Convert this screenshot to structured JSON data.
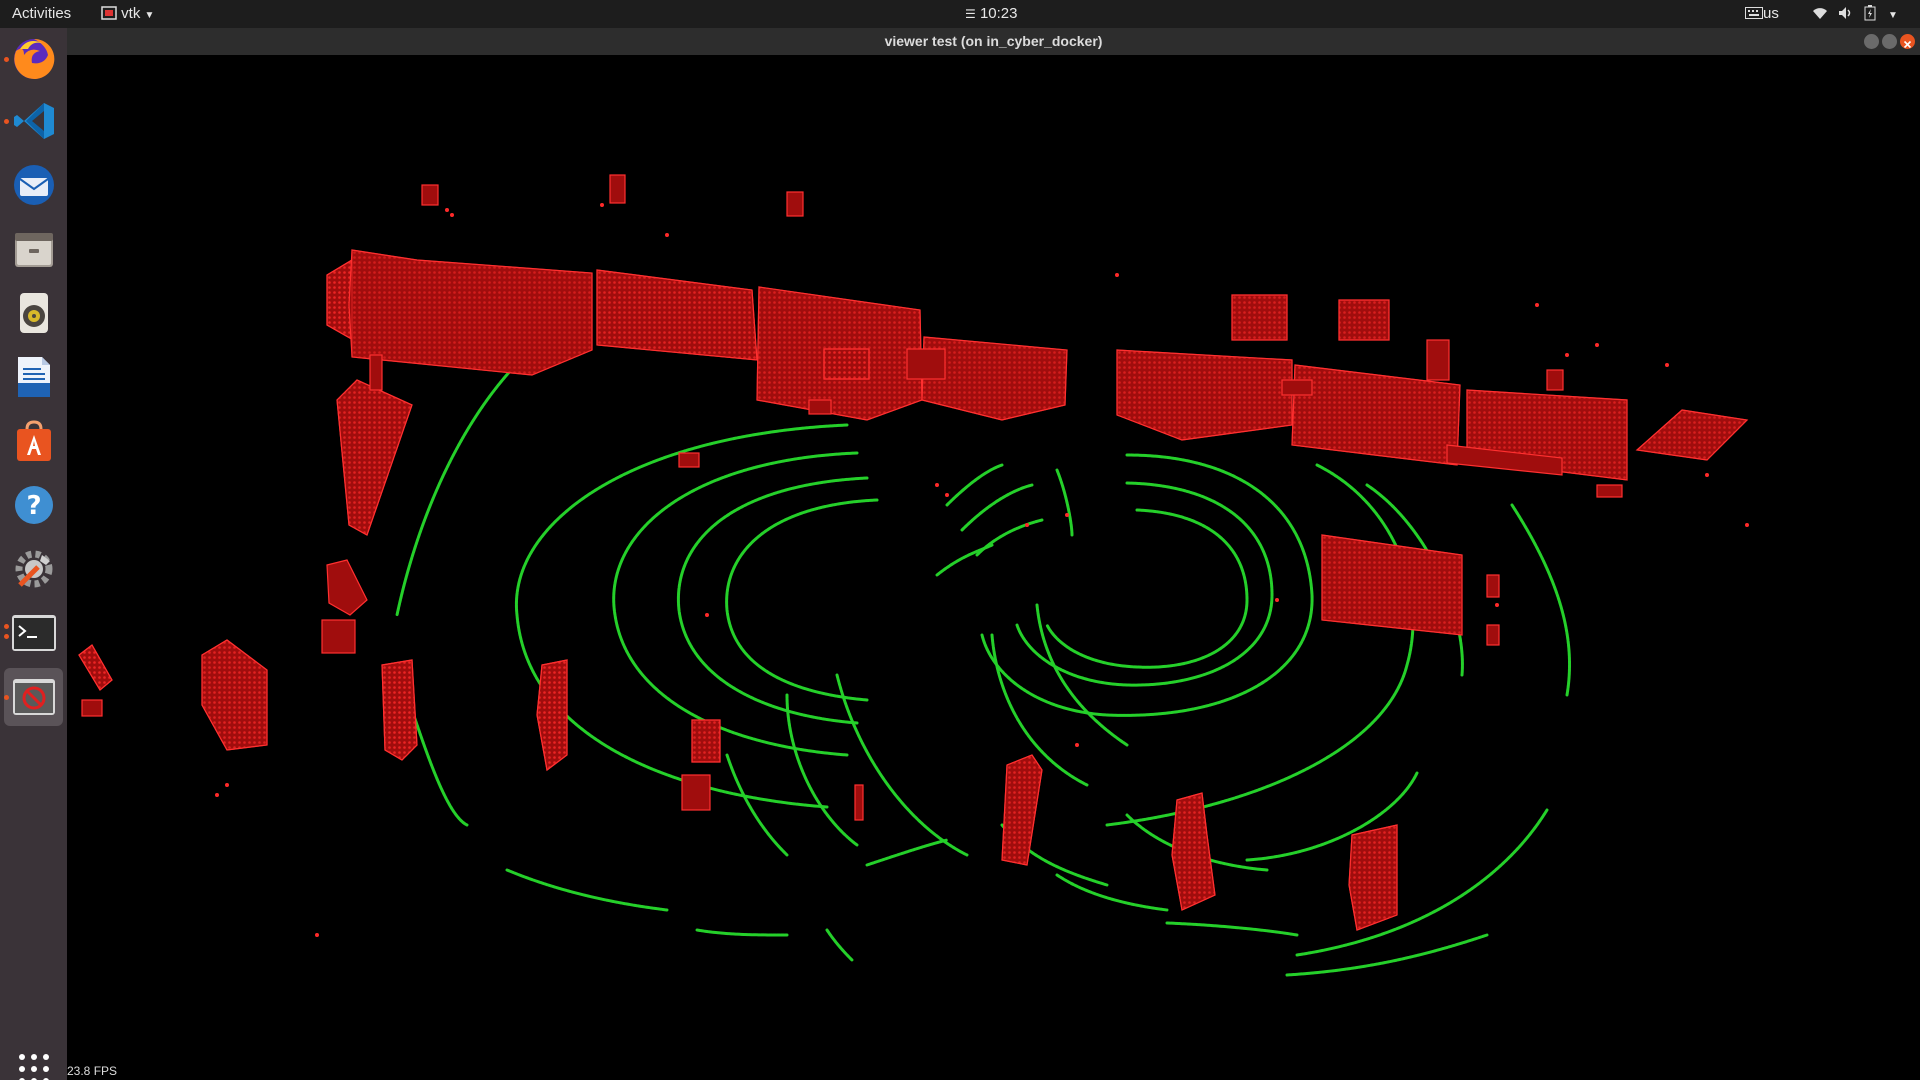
{
  "topbar": {
    "activities": "Activities",
    "app_name": "vtk",
    "clock": "10:23",
    "keyboard_layout": "us"
  },
  "window": {
    "title": "viewer test (on in_cyber_docker)"
  },
  "dock": {
    "items": [
      {
        "name": "firefox",
        "icon": "firefox-icon",
        "running": true
      },
      {
        "name": "vscode",
        "icon": "vscode-icon",
        "running": true
      },
      {
        "name": "thunderbird",
        "icon": "thunderbird-icon",
        "running": false
      },
      {
        "name": "files",
        "icon": "files-icon",
        "running": false
      },
      {
        "name": "rhythmbox",
        "icon": "rhythmbox-icon",
        "running": false
      },
      {
        "name": "writer",
        "icon": "writer-icon",
        "running": false
      },
      {
        "name": "software",
        "icon": "software-icon",
        "running": false
      },
      {
        "name": "help",
        "icon": "help-icon",
        "running": false
      },
      {
        "name": "settings",
        "icon": "settings-icon",
        "running": false
      },
      {
        "name": "terminal",
        "icon": "terminal-icon",
        "running": true
      },
      {
        "name": "vtk",
        "icon": "vtk-icon",
        "running": true,
        "active": true
      }
    ],
    "show_apps_icon": "grid-icon"
  },
  "viewer": {
    "fps_label": "23.8 FPS",
    "colors": {
      "ground": "#25d02a",
      "objects": "#ff1a1a",
      "box_fill": "#b01010"
    }
  }
}
